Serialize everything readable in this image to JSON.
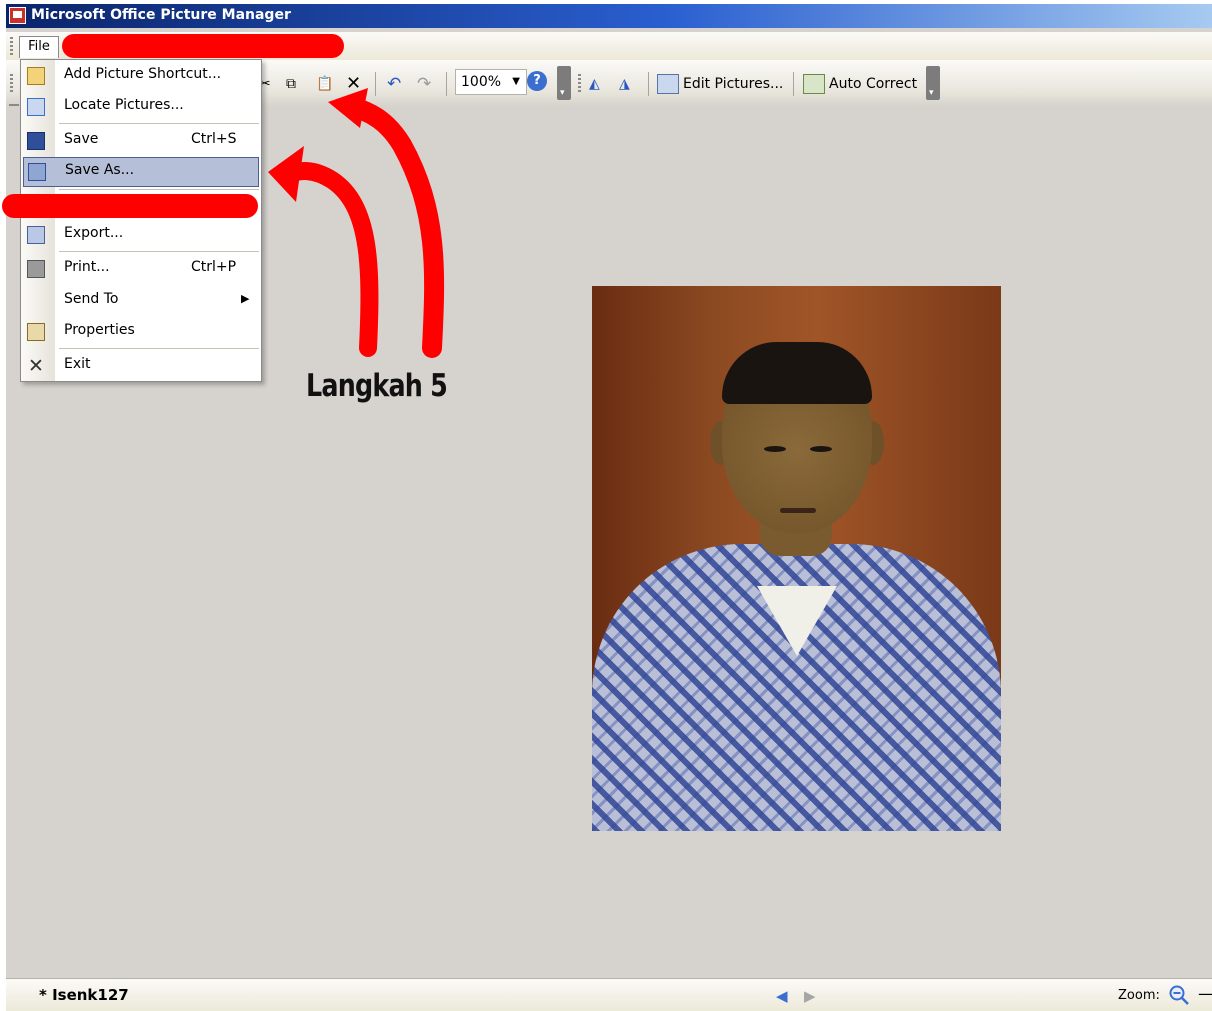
{
  "window": {
    "title": "Microsoft Office Picture Manager"
  },
  "menubar": {
    "file_label": "File"
  },
  "toolbar": {
    "zoom_value": "100%",
    "edit_pictures_label": "Edit Pictures...",
    "auto_correct_label": "Auto Correct"
  },
  "file_menu": {
    "items": [
      {
        "label": "Add Picture Shortcut...",
        "shortcut": "",
        "icon": "add-picture-shortcut-icon"
      },
      {
        "label": "Locate Pictures...",
        "shortcut": "",
        "icon": "locate-pictures-icon"
      },
      {
        "label": "Save",
        "shortcut": "Ctrl+S",
        "icon": "save-icon"
      },
      {
        "label": "Save As...",
        "shortcut": "",
        "icon": "save-as-icon",
        "highlighted": true
      },
      {
        "label": "Export...",
        "shortcut": "",
        "icon": "export-icon"
      },
      {
        "label": "Print...",
        "shortcut": "Ctrl+P",
        "icon": "print-icon"
      },
      {
        "label": "Send To",
        "shortcut": "",
        "icon": "",
        "submenu": true
      },
      {
        "label": "Properties",
        "shortcut": "",
        "icon": "properties-icon"
      },
      {
        "label": "Exit",
        "shortcut": "",
        "icon": "exit-icon"
      }
    ]
  },
  "annotation": {
    "text": "Langkah 5",
    "marker_color": "#ff0000"
  },
  "statusbar": {
    "file_name": "* Isenk127",
    "zoom_label": "Zoom:",
    "zoom_dash": "—"
  },
  "colors": {
    "titlebar_start": "#0a246a",
    "menu_highlight": "#b5bfd7",
    "workspace": "#d6d3ce"
  }
}
